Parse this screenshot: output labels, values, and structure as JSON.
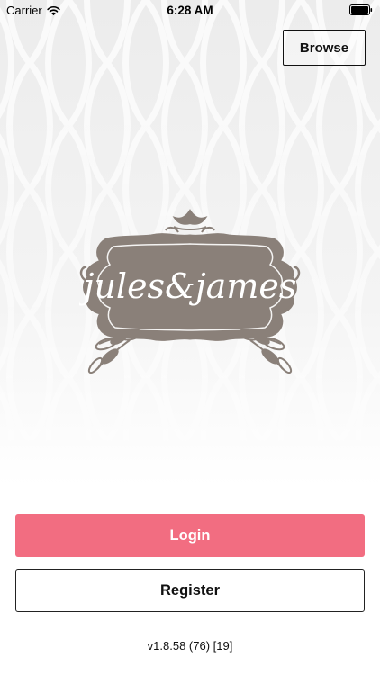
{
  "status_bar": {
    "carrier": "Carrier",
    "time": "6:28 AM",
    "wifi_icon": "wifi-icon",
    "battery_icon": "battery-icon"
  },
  "header": {
    "browse_label": "Browse"
  },
  "logo": {
    "text": "jules&james",
    "brand_color": "#8a8079"
  },
  "actions": {
    "login_label": "Login",
    "register_label": "Register",
    "login_color": "#f26d81"
  },
  "footer": {
    "version": "v1.8.58 (76) [19]"
  }
}
